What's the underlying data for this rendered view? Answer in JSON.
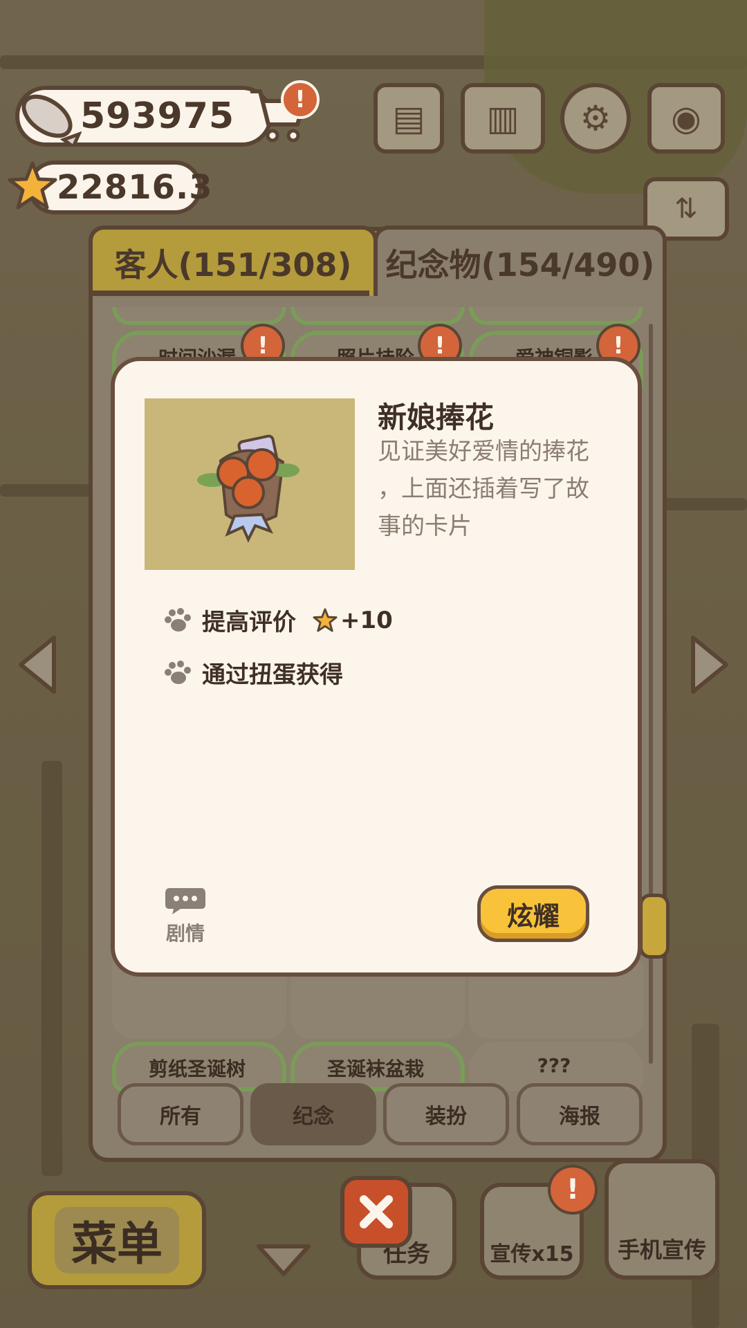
{
  "currency": {
    "fish": "593975",
    "stars": "22816.3"
  },
  "tabs": {
    "guests": "客人(151/308)",
    "mementos": "纪念物(154/490)"
  },
  "grid": {
    "row1": [
      "时间沙漏",
      "照片挂阶",
      "爱神铜影"
    ],
    "row3": [
      "剪纸圣诞树",
      "圣诞袜盆栽",
      "???"
    ]
  },
  "filters": [
    "所有",
    "纪念",
    "装扮",
    "海报"
  ],
  "item": {
    "name": "新娘捧花",
    "description": [
      "见证美好爱情的捧花",
      "，上面还插着写了故",
      "事的卡片"
    ],
    "attr1_label": "提高评价",
    "attr1_value": "+10",
    "attr2_label": "通过扭蛋获得",
    "story_label": "剧情",
    "flaunt_label": "炫耀"
  },
  "bottom": {
    "menu": "菜单",
    "tasks": "任务",
    "promo": "宣传x15",
    "phone_promo": "手机宣传"
  },
  "colors": {
    "accent": "#f8c33b",
    "alert": "#d4643a",
    "outline": "#5a4535"
  },
  "icons": [
    "fish-icon",
    "cart-icon",
    "star-icon",
    "news-icon",
    "book-icon",
    "gear-icon",
    "map-icon",
    "paw-icon",
    "chat-icon",
    "close-icon"
  ]
}
